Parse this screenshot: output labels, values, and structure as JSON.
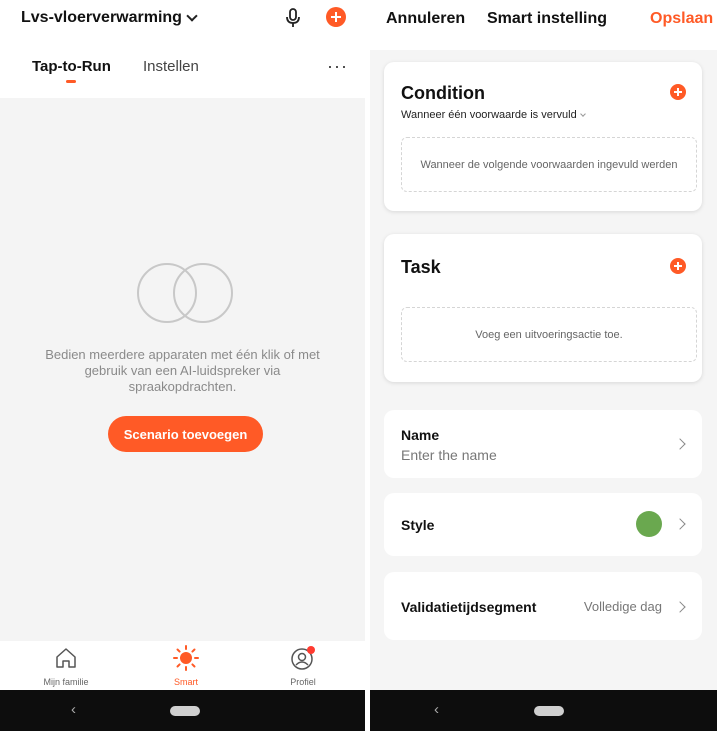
{
  "left": {
    "home_title": "Lvs-vloerverwarming",
    "tabs": [
      {
        "label": "Tap-to-Run",
        "active": true
      },
      {
        "label": "Instellen",
        "active": false
      }
    ],
    "more": "···",
    "empty_message": "Bedien meerdere apparaten met één klik of met gebruik van een AI-luidspreker via spraakopdrachten.",
    "add_button": "Scenario toevoegen",
    "nav": [
      {
        "label": "Mijn familie",
        "icon": "home-icon"
      },
      {
        "label": "Smart",
        "icon": "sun-icon",
        "active": true
      },
      {
        "label": "Profiel",
        "icon": "profile-icon",
        "badge": true
      }
    ]
  },
  "right": {
    "header": {
      "cancel": "Annuleren",
      "title": "Smart instelling",
      "save": "Opslaan"
    },
    "condition": {
      "title": "Condition",
      "mode": "Wanneer één voorwaarde is vervuld",
      "placeholder": "Wanneer de volgende voorwaarden ingevuld werden"
    },
    "task": {
      "title": "Task",
      "placeholder": "Voeg een uitvoeringsactie toe."
    },
    "name_row": {
      "label": "Name",
      "value": "Enter the name"
    },
    "style_row": {
      "label": "Style",
      "color": "#6aa84f"
    },
    "valid_row": {
      "label": "Validatietijdsegment",
      "value": "Volledige dag"
    }
  },
  "colors": {
    "accent": "#ff5a26",
    "style_green": "#6aa84f"
  }
}
